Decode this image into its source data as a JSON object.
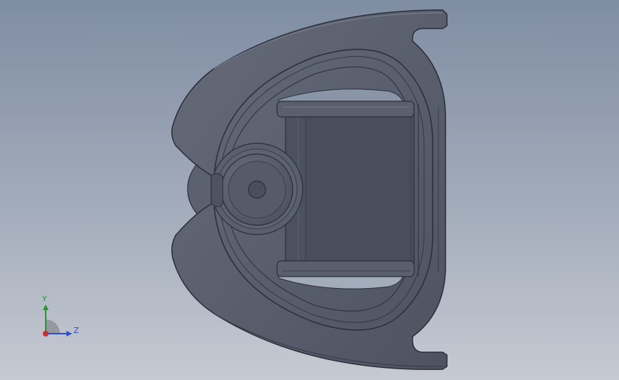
{
  "triad": {
    "y_label": "Y",
    "z_label": "Z",
    "colors": {
      "y_axis": "#2f8f3a",
      "z_axis": "#2b4fd1",
      "x_axis": "#c23030"
    }
  },
  "model": {
    "colors": {
      "body": "#5a5f6e",
      "edge": "#2b2e38",
      "inner_face": "#4c5160",
      "highlight": "#767b89"
    }
  }
}
